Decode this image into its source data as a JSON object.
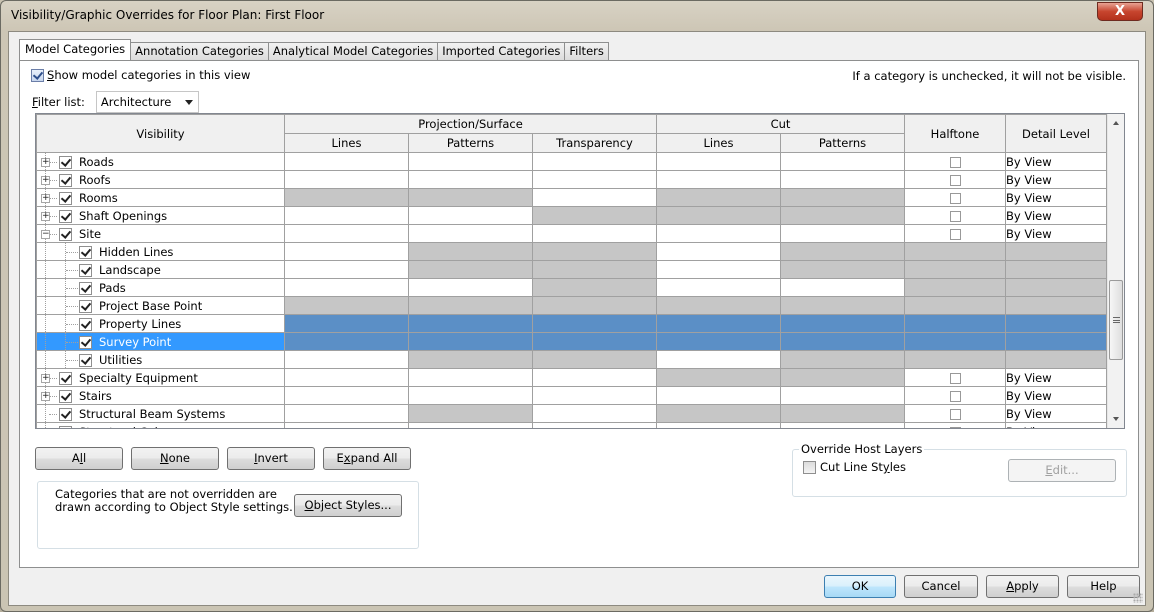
{
  "window": {
    "title": "Visibility/Graphic Overrides for Floor Plan: First Floor",
    "close_glyph": "X"
  },
  "tabs": [
    {
      "label": "Model Categories",
      "active": true
    },
    {
      "label": "Annotation Categories",
      "active": false
    },
    {
      "label": "Analytical Model Categories",
      "active": false
    },
    {
      "label": "Imported Categories",
      "active": false
    },
    {
      "label": "Filters",
      "active": false
    }
  ],
  "options": {
    "show_model_categories_label": "Show model categories in this view",
    "show_model_categories_checked": true,
    "notice": "If a category is unchecked, it will not be visible.",
    "filter_list_label": "Filter list:",
    "filter_list_value": "Architecture"
  },
  "grid": {
    "headers": {
      "visibility": "Visibility",
      "projection_surface": "Projection/Surface",
      "cut": "Cut",
      "halftone": "Halftone",
      "detail_level": "Detail Level",
      "proj_lines": "Lines",
      "proj_patterns": "Patterns",
      "transparency": "Transparency",
      "cut_lines": "Lines",
      "cut_patterns": "Patterns"
    },
    "rows": [
      {
        "name": "Roads",
        "level": 0,
        "expander": "+",
        "checked": true,
        "cells": [
          "w",
          "w",
          "w",
          "w",
          "w"
        ],
        "halftone": "checkbox",
        "halftone_checked": false,
        "detail": "By View"
      },
      {
        "name": "Roofs",
        "level": 0,
        "expander": "+",
        "checked": true,
        "cells": [
          "w",
          "w",
          "w",
          "w",
          "w"
        ],
        "halftone": "checkbox",
        "halftone_checked": false,
        "detail": "By View"
      },
      {
        "name": "Rooms",
        "level": 0,
        "expander": "+",
        "checked": true,
        "cells": [
          "h",
          "h",
          "w",
          "h",
          "h"
        ],
        "halftone": "checkbox",
        "halftone_checked": false,
        "detail": "By View"
      },
      {
        "name": "Shaft Openings",
        "level": 0,
        "expander": "+",
        "checked": true,
        "cells": [
          "w",
          "w",
          "h",
          "h",
          "h"
        ],
        "halftone": "checkbox",
        "halftone_checked": false,
        "detail": "By View"
      },
      {
        "name": "Site",
        "level": 0,
        "expander": "-",
        "checked": true,
        "cells": [
          "w",
          "w",
          "w",
          "w",
          "w"
        ],
        "halftone": "checkbox",
        "halftone_checked": false,
        "detail": "By View"
      },
      {
        "name": "Hidden Lines",
        "level": 1,
        "expander": "",
        "checked": true,
        "cells": [
          "w",
          "h",
          "h",
          "w",
          "h"
        ],
        "halftone": "hatch",
        "detail": ""
      },
      {
        "name": "Landscape",
        "level": 1,
        "expander": "",
        "checked": true,
        "cells": [
          "w",
          "h",
          "h",
          "w",
          "h"
        ],
        "halftone": "hatch",
        "detail": ""
      },
      {
        "name": "Pads",
        "level": 1,
        "expander": "",
        "checked": true,
        "cells": [
          "w",
          "w",
          "h",
          "w",
          "w"
        ],
        "halftone": "hatch",
        "detail": ""
      },
      {
        "name": "Project Base Point",
        "level": 1,
        "expander": "",
        "checked": true,
        "cells": [
          "h",
          "h",
          "h",
          "h",
          "h"
        ],
        "halftone": "hatch",
        "detail": ""
      },
      {
        "name": "Property Lines",
        "level": 1,
        "expander": "",
        "checked": true,
        "cells": [
          "b",
          "b",
          "b",
          "b",
          "b"
        ],
        "halftone": "blue",
        "detail": ""
      },
      {
        "name": "Survey Point",
        "level": 1,
        "expander": "",
        "checked": true,
        "cells": [
          "b",
          "b",
          "b",
          "b",
          "b"
        ],
        "halftone": "blue",
        "detail": "",
        "selected": true
      },
      {
        "name": "Utilities",
        "level": 1,
        "expander": "",
        "checked": true,
        "cells": [
          "w",
          "h",
          "h",
          "w",
          "h"
        ],
        "halftone": "hatch",
        "detail": ""
      },
      {
        "name": "Specialty Equipment",
        "level": 0,
        "expander": "+",
        "checked": true,
        "cells": [
          "w",
          "w",
          "w",
          "h",
          "h"
        ],
        "halftone": "checkbox",
        "halftone_checked": false,
        "detail": "By View"
      },
      {
        "name": "Stairs",
        "level": 0,
        "expander": "+",
        "checked": true,
        "cells": [
          "w",
          "w",
          "w",
          "w",
          "w"
        ],
        "halftone": "checkbox",
        "halftone_checked": false,
        "detail": "By View"
      },
      {
        "name": "Structural Beam Systems",
        "level": 0,
        "expander": "",
        "checked": true,
        "cells": [
          "w",
          "h",
          "w",
          "h",
          "h"
        ],
        "halftone": "checkbox",
        "halftone_checked": false,
        "detail": "By View"
      },
      {
        "name": "Structural Columns",
        "level": 0,
        "expander": "+",
        "checked": true,
        "cells": [
          "w",
          "w",
          "w",
          "w",
          "w"
        ],
        "halftone": "checkbox",
        "halftone_checked": false,
        "detail": "By View"
      }
    ]
  },
  "buttons": {
    "all": "All",
    "none": "None",
    "invert": "Invert",
    "expand_all": "Expand All",
    "object_styles": "Object Styles...",
    "edit": "Edit...",
    "ok": "OK",
    "cancel": "Cancel",
    "apply": "Apply",
    "help": "Help"
  },
  "info": {
    "text": "Categories that are not overridden are drawn according to Object Style settings."
  },
  "override_host_layers": {
    "legend": "Override Host Layers",
    "cut_line_styles_label": "Cut Line Styles",
    "cut_line_styles_checked": false
  }
}
